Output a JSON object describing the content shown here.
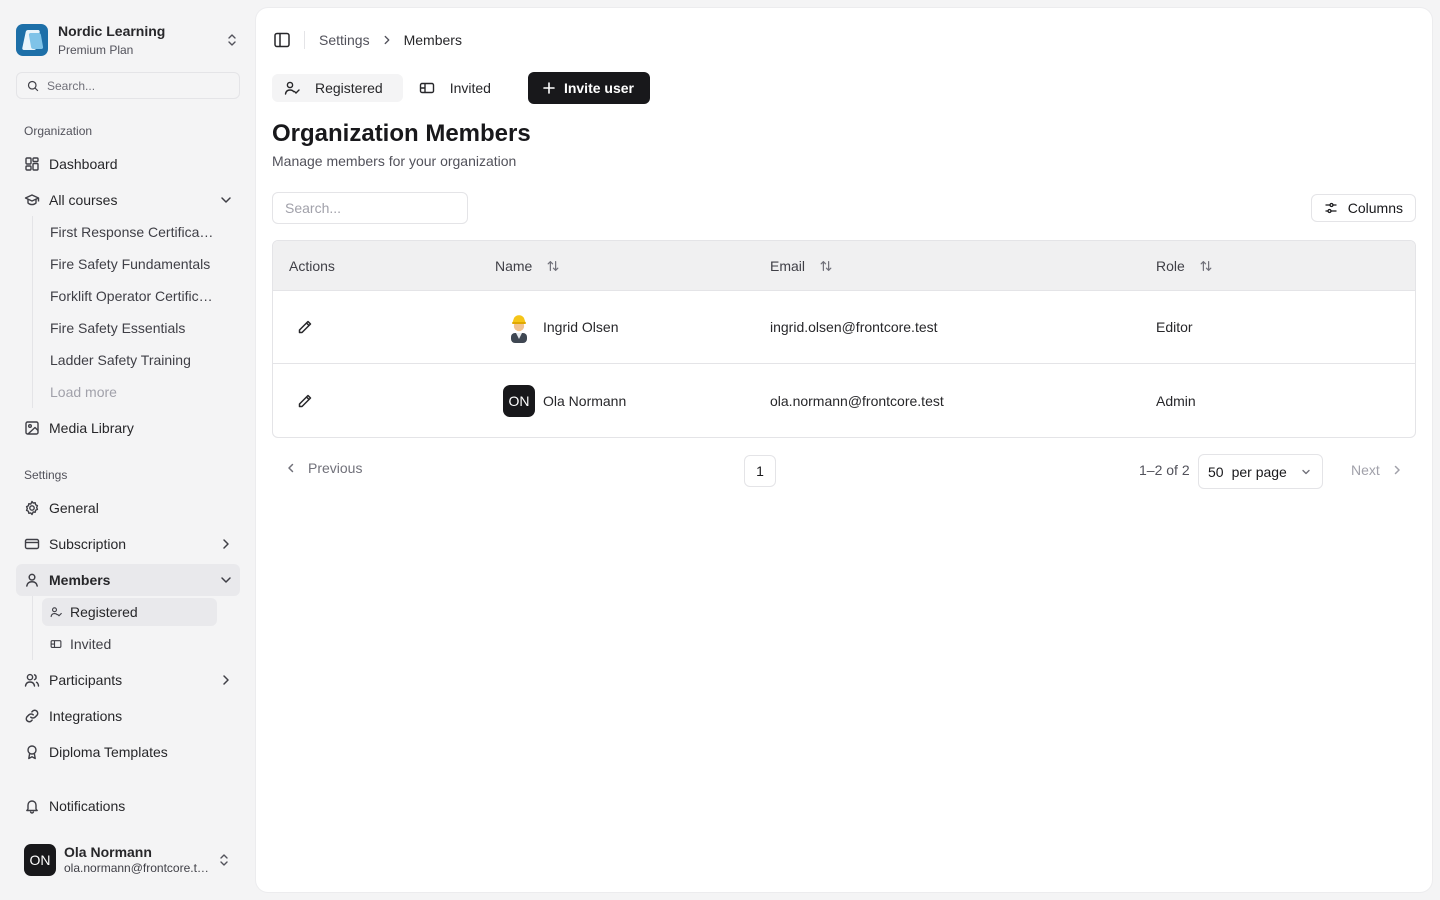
{
  "org": {
    "name": "Nordic Learning",
    "plan": "Premium Plan"
  },
  "sidebar": {
    "search_placeholder": "Search...",
    "group_org": "Organization",
    "dashboard": "Dashboard",
    "all_courses": "All courses",
    "courses": [
      "First Response Certification",
      "Fire Safety Fundamentals",
      "Forklift Operator Certification",
      "Fire Safety Essentials",
      "Ladder Safety Training"
    ],
    "load_more": "Load more",
    "media_library": "Media Library",
    "group_settings": "Settings",
    "general": "General",
    "subscription": "Subscription",
    "members": "Members",
    "members_sub": [
      "Registered",
      "Invited"
    ],
    "participants": "Participants",
    "integrations": "Integrations",
    "diploma_templates": "Diploma Templates",
    "notifications": "Notifications"
  },
  "user": {
    "initials": "ON",
    "name": "Ola Normann",
    "email": "ola.normann@frontcore.test"
  },
  "breadcrumb": {
    "parent": "Settings",
    "current": "Members"
  },
  "tabs": {
    "registered": "Registered",
    "invited": "Invited",
    "invite_button": "Invite user"
  },
  "page": {
    "title": "Organization Members",
    "subtitle": "Manage members for your organization"
  },
  "toolbar": {
    "search_placeholder": "Search...",
    "columns_label": "Columns"
  },
  "table": {
    "headers": {
      "actions": "Actions",
      "name": "Name",
      "email": "Email",
      "role": "Role"
    },
    "rows": [
      {
        "name": "Ingrid Olsen",
        "email": "ingrid.olsen@frontcore.test",
        "role": "Editor",
        "avatar": "emoji-avatar"
      },
      {
        "name": "Ola Normann",
        "email": "ola.normann@frontcore.test",
        "role": "Admin",
        "avatar_initials": "ON"
      }
    ]
  },
  "pagination": {
    "previous": "Previous",
    "page": "1",
    "range": "1–2 of 2",
    "per_page_value": "50",
    "per_page_label": "per page",
    "next": "Next"
  }
}
